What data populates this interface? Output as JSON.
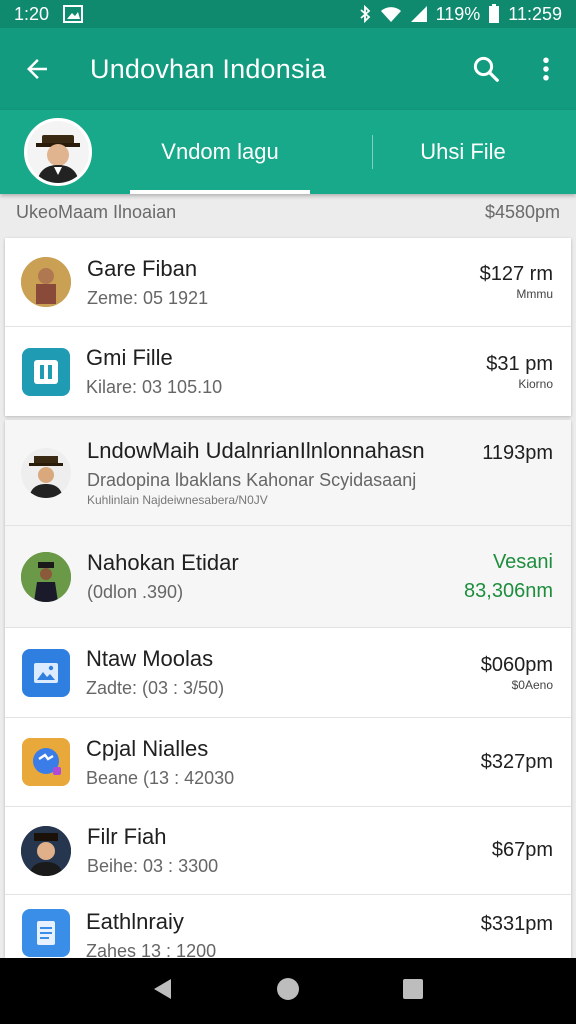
{
  "status": {
    "time": "1:20",
    "battery": "119%",
    "clock": "11:259"
  },
  "app_bar": {
    "title": "Undovhan Indonsia"
  },
  "tabs": [
    {
      "label": "Vndom lagu"
    },
    {
      "label": "Uhsi File"
    }
  ],
  "summary": {
    "left": "UkeoMaam Ilnoaian",
    "right": "$4580pm"
  },
  "rows": [
    {
      "title": "Gare Fiban",
      "sub": "Zeme: 05 1921",
      "amount": "$127 rm",
      "amount_sub": "Mmmu"
    },
    {
      "title": "Gmi Fille",
      "sub": "Kilare: 03 105.10",
      "amount": "$31 pm",
      "amount_sub": "Kiorno"
    },
    {
      "title": "LndowMaih UdalnrianIlnlonnahasn",
      "sub": "Dradopina lbaklans Kahonar Scyidasaanj",
      "sub2": "Kuhlinlain Najdeiwnesabera/N0JV",
      "amount": "1193pm"
    },
    {
      "title": "Nahokan Etidar",
      "sub": "(0dlon .390)",
      "amount": "Vesani",
      "amount_sub": "83,306nm"
    },
    {
      "title": "Ntaw Moolas",
      "sub": "Zadte: (03 : 3/50)",
      "amount": "$060pm",
      "amount_sub": "$0Aeno"
    },
    {
      "title": "Cpjal Nialles",
      "sub": "Beane (13 : 42030",
      "amount": "$327pm"
    },
    {
      "title": "Filr Fiah",
      "sub": "Beihe: 03 : 3300",
      "amount": "$67pm"
    },
    {
      "title": "Eathlnraiy",
      "sub": "Zahes 13 : 1200",
      "amount": "$331pm"
    }
  ],
  "colors": {
    "primary": "#129b7e",
    "tab_bar": "#17a98a",
    "status_bar": "#0f8a6e",
    "accent_green": "#1e8e3e"
  },
  "icons": [
    "back-arrow-icon",
    "search-icon",
    "more-vert-icon",
    "wifi-icon",
    "signal-icon",
    "battery-icon",
    "bluetooth-icon",
    "gallery-icon",
    "messenger-icon",
    "docs-icon",
    "app-icon"
  ]
}
